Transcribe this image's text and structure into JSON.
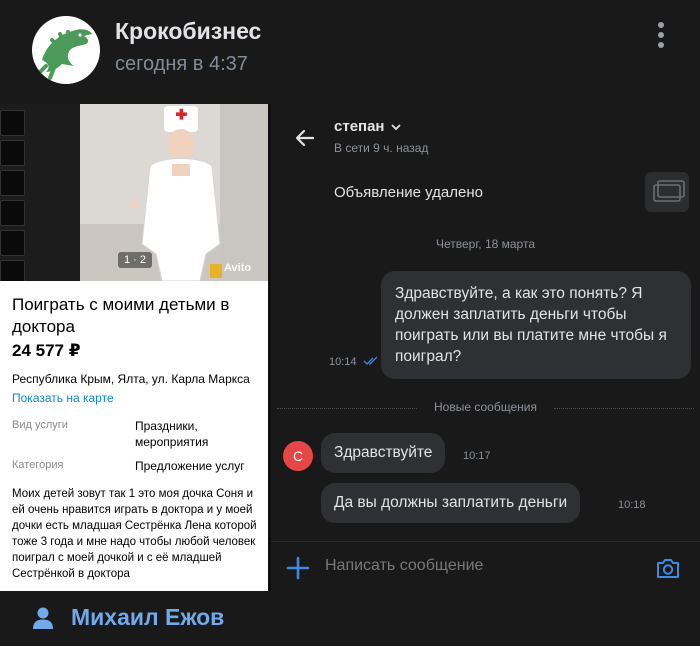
{
  "post": {
    "author": "Крокобизнес",
    "time": "сегодня в 4:37"
  },
  "ad": {
    "photo_counter": "1 · 2",
    "watermark": "Avito",
    "title": "Поиграть с моими детьми в доктора",
    "price": "24 577 ₽",
    "address": "Республика Крым, Ялта, ул. Карла Маркса",
    "map_link": "Показать на карте",
    "service_type_label": "Вид услуги",
    "service_type_value": "Праздники, мероприятия",
    "category_label": "Категория",
    "category_value": "Предложение услуг",
    "description": "Моих детей зовут так 1 это моя дочка Соня и ей очень нравится играть в доктора и у моей дочки  есть младшая Сестрёнка Лена которой тоже 3 года  и мне надо чтобы любой человек поиграл с моей дочкой и с её младшей Сестрёнкой в доктора"
  },
  "chat": {
    "contact_name": "степан",
    "status": "В сети 9 ч. назад",
    "ad_removed": "Объявление удалено",
    "date_separator": "Четверг, 18 марта",
    "outgoing_message": "Здравствуйте, а как это понять? Я должен заплатить деньги чтобы поиграть или вы платите мне чтобы я поиграл?",
    "outgoing_time": "10:14",
    "new_messages_label": "Новые сообщения",
    "sender_initial": "С",
    "incoming_messages": [
      {
        "text": "Здравствуйте",
        "time": "10:17"
      },
      {
        "text": "Да вы должны заплатить деньги",
        "time": "10:18"
      }
    ],
    "composer_placeholder": "Написать сообщение"
  },
  "comment": {
    "user_name": "Михаил Ежов"
  },
  "colors": {
    "background": "#19191a",
    "bubble": "#2f3033",
    "link_blue": "#71aaeb",
    "accent_blue": "#3f8ae0",
    "avatar_red": "#e64646",
    "croc_green": "#4c9a5a"
  },
  "icons": {
    "more": "vertical-dots-icon",
    "back": "arrow-left-icon",
    "chevron": "chevron-down-icon",
    "read": "double-check-icon",
    "attach": "plus-icon",
    "camera": "camera-icon",
    "user": "person-icon",
    "group_avatar": "crocodile-logo"
  }
}
